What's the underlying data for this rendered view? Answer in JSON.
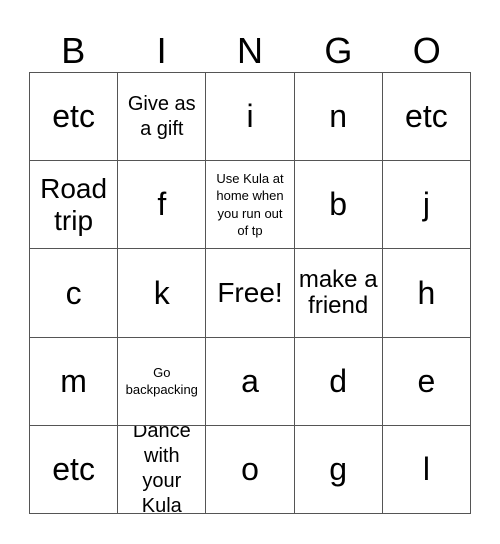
{
  "card": {
    "header": [
      "B",
      "I",
      "N",
      "G",
      "O"
    ],
    "rows": [
      [
        {
          "text": "etc",
          "size": "xl"
        },
        {
          "text": "Give as a gift",
          "size": "sm"
        },
        {
          "text": "i",
          "size": "xl"
        },
        {
          "text": "n",
          "size": "xl"
        },
        {
          "text": "etc",
          "size": "xl"
        }
      ],
      [
        {
          "text": "Road trip",
          "size": "lg"
        },
        {
          "text": "f",
          "size": "xl"
        },
        {
          "text": "Use Kula at home when you run out of tp",
          "size": "xs"
        },
        {
          "text": "b",
          "size": "xl"
        },
        {
          "text": "j",
          "size": "xl"
        }
      ],
      [
        {
          "text": "c",
          "size": "xl"
        },
        {
          "text": "k",
          "size": "xl"
        },
        {
          "text": "Free!",
          "size": "lg"
        },
        {
          "text": "make a friend",
          "size": "md"
        },
        {
          "text": "h",
          "size": "xl"
        }
      ],
      [
        {
          "text": "m",
          "size": "xl"
        },
        {
          "text": "Go backpacking",
          "size": "xs"
        },
        {
          "text": "a",
          "size": "xl"
        },
        {
          "text": "d",
          "size": "xl"
        },
        {
          "text": "e",
          "size": "xl"
        }
      ],
      [
        {
          "text": "etc",
          "size": "xl"
        },
        {
          "text": "Dance with your Kula",
          "size": "sm"
        },
        {
          "text": "o",
          "size": "xl"
        },
        {
          "text": "g",
          "size": "xl"
        },
        {
          "text": "l",
          "size": "xl"
        }
      ]
    ]
  }
}
